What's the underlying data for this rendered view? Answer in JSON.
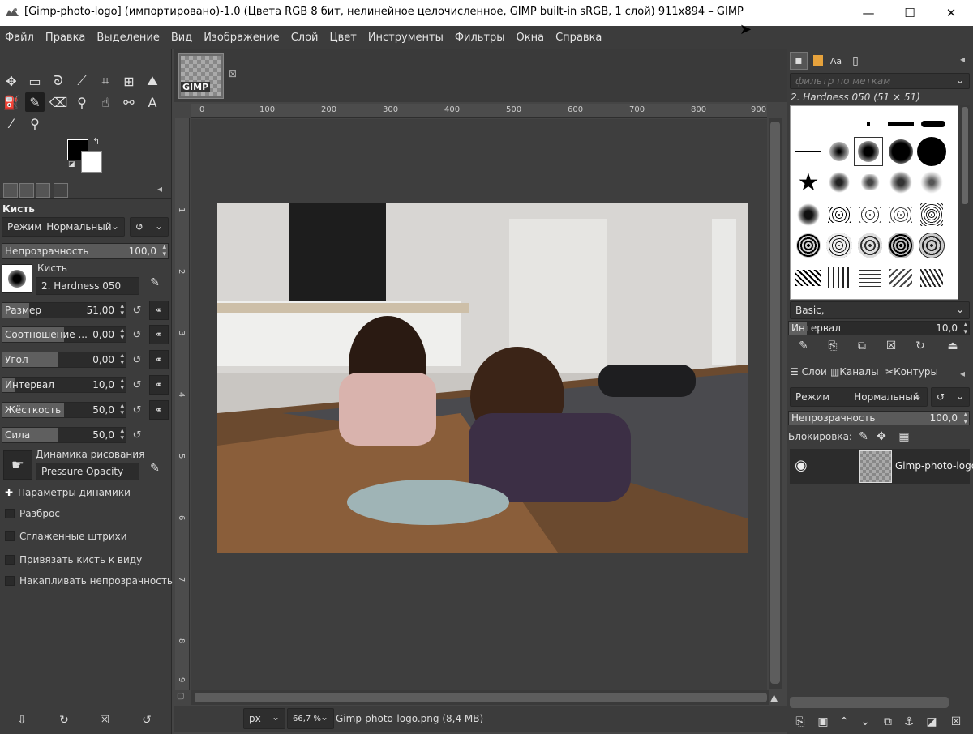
{
  "window": {
    "title": "[Gimp-photo-logo] (импортировано)-1.0 (Цвета RGB 8 бит, нелинейное целочисленное, GIMP built-in sRGB, 1 слой) 911x894 – GIMP",
    "minimize": "—",
    "maximize": "☐",
    "close": "✕"
  },
  "menu": [
    "Файл",
    "Правка",
    "Выделение",
    "Вид",
    "Изображение",
    "Слой",
    "Цвет",
    "Инструменты",
    "Фильтры",
    "Окна",
    "Справка"
  ],
  "tool_options": {
    "title": "Кисть",
    "mode_label": "Режим",
    "mode_value": "Нормальный",
    "opacity_label": "Непрозрачность",
    "opacity_value": "100,0",
    "brush_label": "Кисть",
    "brush_value": "2. Hardness 050",
    "sliders": [
      {
        "name": "Размер",
        "value": "51,00",
        "fill": 0.22
      },
      {
        "name": "Соотношение ...",
        "value": "0,00",
        "fill": 0.5
      },
      {
        "name": "Угол",
        "value": "0,00",
        "fill": 0.45
      },
      {
        "name": "Интервал",
        "value": "10,0",
        "fill": 0.1
      },
      {
        "name": "Жёсткость",
        "value": "50,0",
        "fill": 0.5
      },
      {
        "name": "Сила",
        "value": "50,0",
        "fill": 0.45
      }
    ],
    "dynamics_label": "Динамика рисования",
    "dynamics_value": "Pressure Opacity",
    "dynamics_params": "Параметры динамики",
    "checks": [
      "Разброс",
      "Сглаженные штрихи",
      "Привязать кисть к виду",
      "Накапливать непрозрачность"
    ]
  },
  "image": {
    "filename_status": "Gimp-photo-logo.png (8,4 MB)",
    "unit": "px",
    "zoom": "66,7 %",
    "ruler_top": [
      "0",
      "100",
      "200",
      "300",
      "400",
      "500",
      "600",
      "700",
      "800",
      "900"
    ],
    "ruler_left": [
      "1",
      "2",
      "3",
      "4",
      "5",
      "6",
      "7",
      "8",
      "9"
    ]
  },
  "brushes_panel": {
    "filter_placeholder": "фильтр по меткам",
    "selected_brush": "2. Hardness 050 (51 × 51)",
    "preset": "Basic,",
    "spacing_label": "Интервал",
    "spacing_value": "10,0"
  },
  "layers_panel": {
    "tabs": [
      "Слои",
      "Каналы",
      "Контуры"
    ],
    "mode_label": "Режим",
    "mode_value": "Нормальный",
    "opacity_label": "Непрозрачность",
    "opacity_value": "100,0",
    "lock_label": "Блокировка:",
    "layer_name": "Gimp-photo-logo"
  },
  "thumb_label": "GIMP"
}
